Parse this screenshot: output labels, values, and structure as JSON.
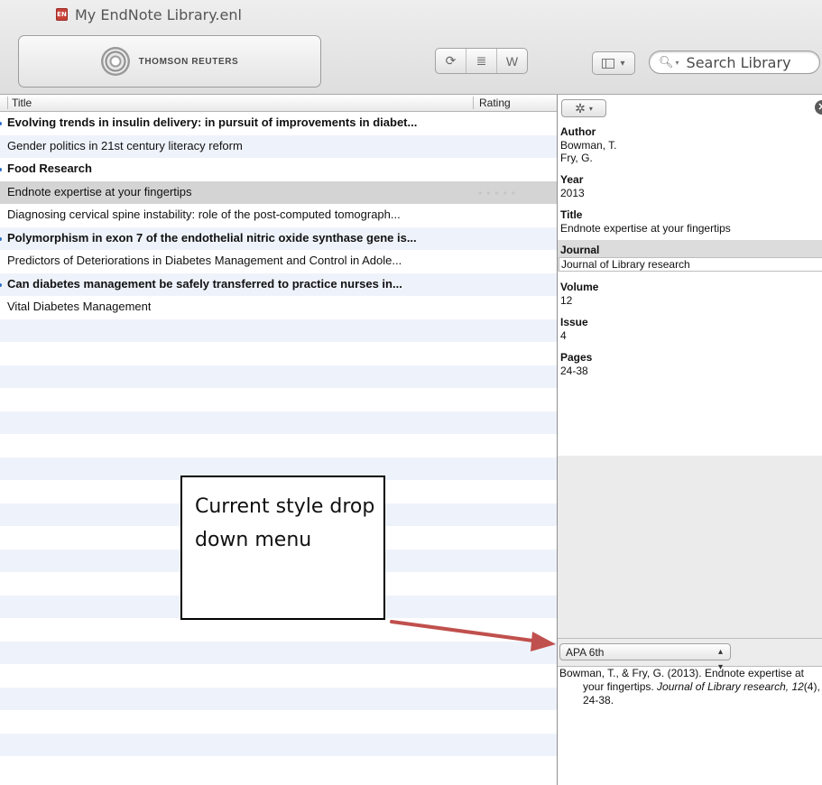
{
  "window": {
    "title": "My EndNote Library.enl",
    "doc_icon_label": "EN"
  },
  "toolbar": {
    "vendor_name": "THOMSON REUTERS",
    "buttons": [
      {
        "name": "sync-button",
        "icon": "sync-icon",
        "glyph": "⟳"
      },
      {
        "name": "find-full-text-button",
        "icon": "note-icon",
        "glyph": "≣"
      },
      {
        "name": "word-insert-button",
        "icon": "word-icon",
        "glyph": "W"
      }
    ],
    "layout_button_icon": "layout-icon",
    "search": {
      "placeholder": "Search Library",
      "value": ""
    }
  },
  "reference_list": {
    "columns": {
      "title": "Title",
      "rating": "Rating"
    },
    "rows": [
      {
        "title": "Evolving trends in insulin delivery: in pursuit of improvements in diabet...",
        "unread": true,
        "selected": false
      },
      {
        "title": "Gender politics in 21st century literacy reform",
        "unread": false,
        "selected": false
      },
      {
        "title": "Food Research",
        "unread": true,
        "selected": false
      },
      {
        "title": "Endnote expertise at your fingertips",
        "unread": false,
        "selected": true
      },
      {
        "title": "Diagnosing cervical spine instability: role of the post-computed tomograph...",
        "unread": false,
        "selected": false
      },
      {
        "title": "Polymorphism in exon 7 of the endothelial nitric oxide synthase gene is...",
        "unread": true,
        "selected": false
      },
      {
        "title": "Predictors of Deteriorations in Diabetes Management and Control in Adole...",
        "unread": false,
        "selected": false
      },
      {
        "title": "Can diabetes management be safely transferred to practice nurses in...",
        "unread": true,
        "selected": false
      },
      {
        "title": "Vital Diabetes Management",
        "unread": false,
        "selected": false
      }
    ],
    "empty_row_count": 20
  },
  "details": {
    "fields": [
      {
        "label": "Author",
        "value": "Bowman, T.\nFry, G.",
        "highlighted": false
      },
      {
        "label": "Year",
        "value": "2013",
        "highlighted": false
      },
      {
        "label": "Title",
        "value": "Endnote expertise at your fingertips",
        "highlighted": false
      },
      {
        "label": "Journal",
        "value": "Journal of Library research",
        "highlighted": true
      },
      {
        "label": "Volume",
        "value": "12",
        "highlighted": false
      },
      {
        "label": "Issue",
        "value": "4",
        "highlighted": false
      },
      {
        "label": "Pages",
        "value": "24-38",
        "highlighted": false
      }
    ],
    "style": {
      "selected": "APA 6th"
    },
    "citation": {
      "authors_year": "Bowman, T., & Fry, G. (2013). Endnote expertise at your fingertips. ",
      "journal": "Journal of Library research, 12",
      "issue_pages": "(4), 24-38."
    }
  },
  "annotation": {
    "text": "Current style drop down menu",
    "arrow_color": "#c0504d"
  },
  "colors": {
    "stripe": "#eef3fb",
    "selection": "#d4d4d4",
    "details_bg": "#ebebeb"
  }
}
